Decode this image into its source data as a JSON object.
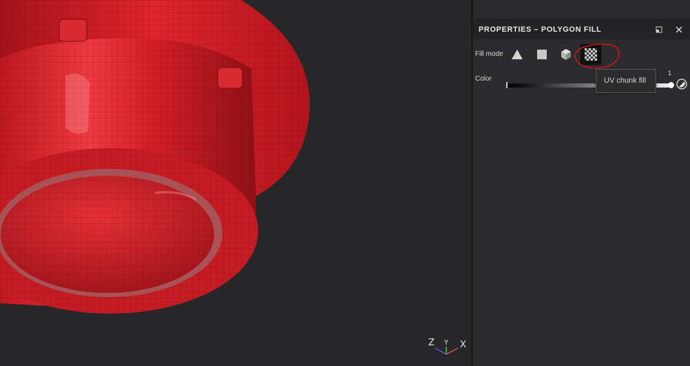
{
  "panel": {
    "title": "PROPERTIES – POLYGON FILL",
    "float_icon": "float-window-icon",
    "close_icon": "close-icon"
  },
  "fill_mode": {
    "label": "Fill mode",
    "modes": [
      {
        "icon": "triangle-icon",
        "selected": false
      },
      {
        "icon": "square-icon",
        "selected": false
      },
      {
        "icon": "cube-icon",
        "selected": false
      },
      {
        "icon": "checkerboard-icon",
        "selected": true
      }
    ]
  },
  "color": {
    "label": "Color",
    "value_label": "1",
    "value": 1,
    "picker_icon": "color-picker-icon"
  },
  "tooltip": {
    "text": "UV chunk fill"
  },
  "viewport": {
    "model": "red-fire-hydrant-mesh",
    "axis_labels": {
      "z": "Z",
      "y": "Y",
      "x": "X"
    }
  },
  "colors": {
    "model_red": "#d81f26",
    "highlight_circle": "#d0121c",
    "panel_bg": "#2c2c2e",
    "viewport_bg": "#272729"
  }
}
